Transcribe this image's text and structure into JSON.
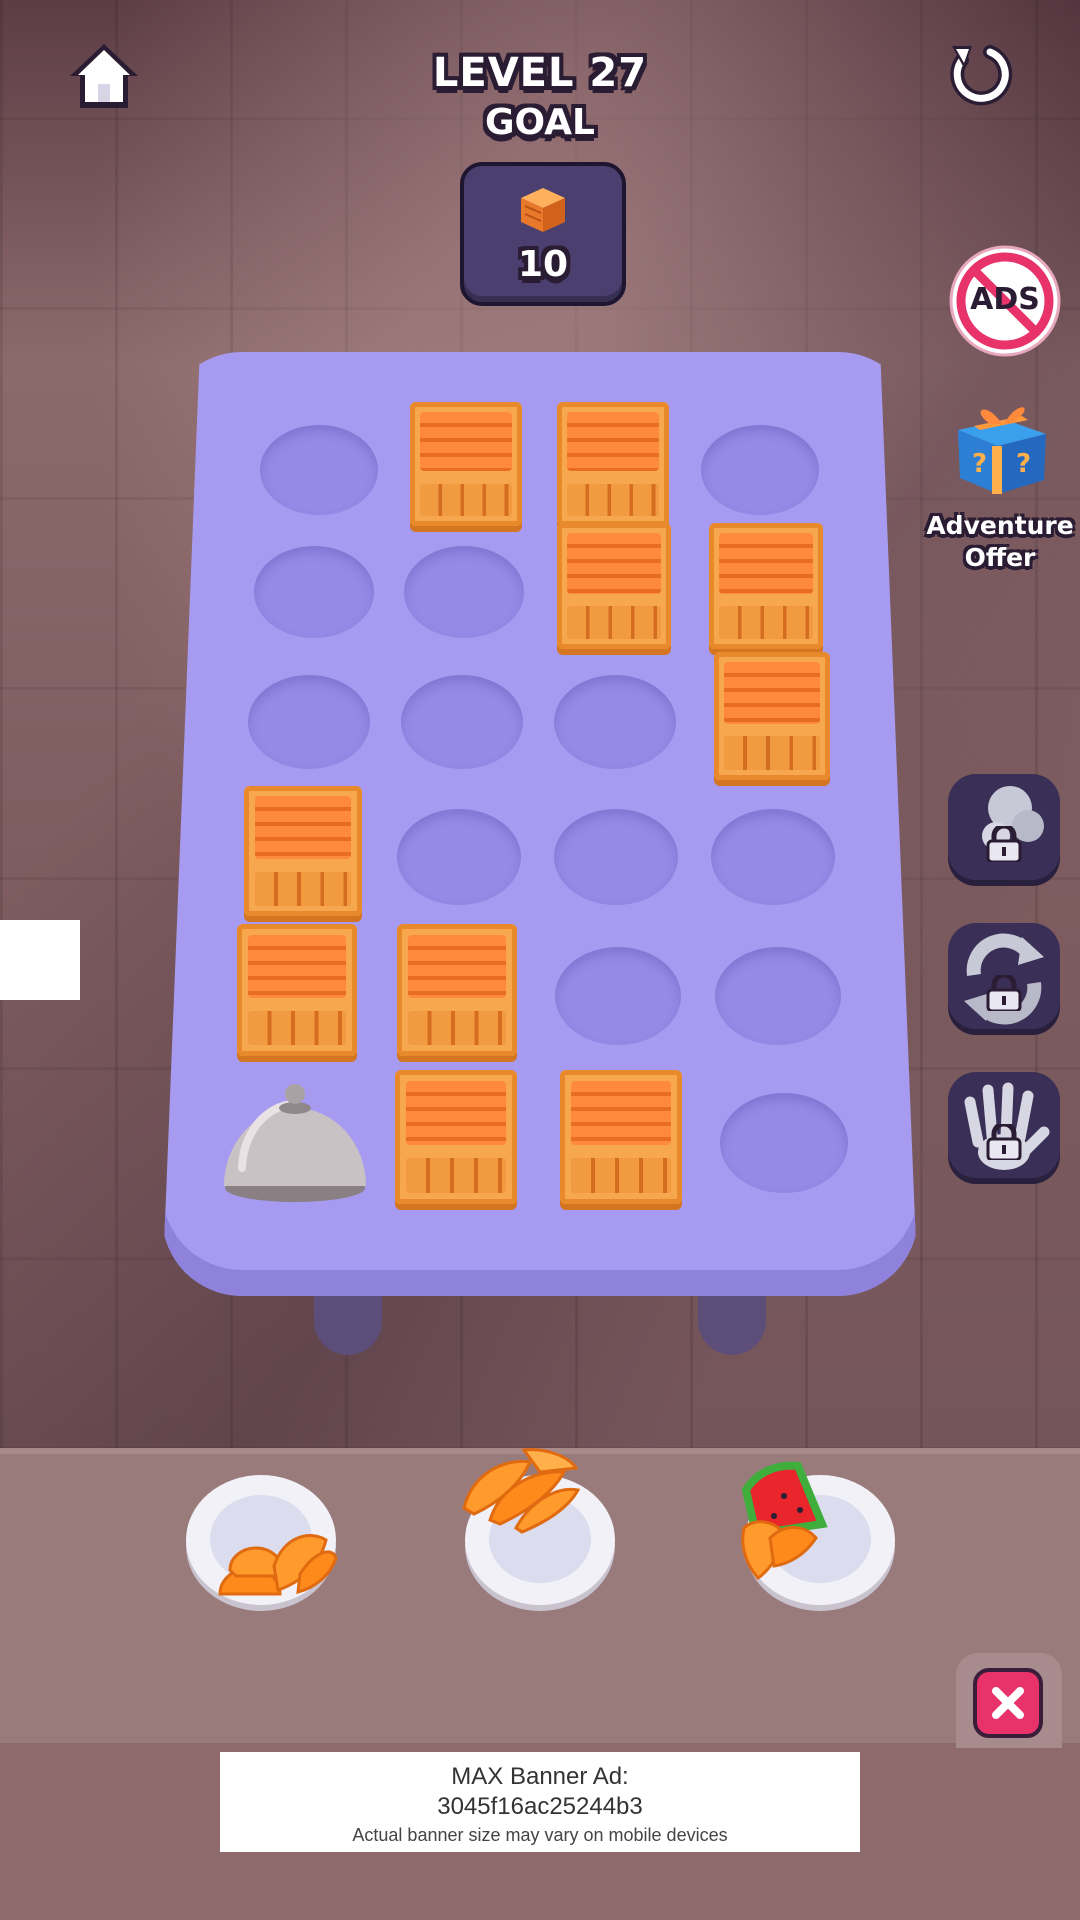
{
  "header": {
    "level_label": "LEVEL 27",
    "goal_label": "GOAL",
    "goal_item_icon": "crate-icon",
    "goal_count": "10"
  },
  "toolbar": {
    "home_icon": "home-icon",
    "restart_icon": "restart-icon"
  },
  "side_panel": {
    "no_ads_icon": "no-ads-icon",
    "no_ads_text": "ADS",
    "adventure_offer_line1": "Adventure",
    "adventure_offer_line2": "Offer",
    "boosters": [
      {
        "icon": "magnet-booster-icon",
        "locked": true
      },
      {
        "icon": "shuffle-booster-icon",
        "locked": true
      },
      {
        "icon": "grab-hand-booster-icon",
        "locked": true
      }
    ]
  },
  "board": {
    "rows": 6,
    "cols": 4,
    "cells": [
      [
        "empty",
        "crate",
        "crate",
        "empty"
      ],
      [
        "empty",
        "empty",
        "crate",
        "crate"
      ],
      [
        "empty",
        "empty",
        "empty",
        "crate"
      ],
      [
        "crate",
        "empty",
        "empty",
        "empty"
      ],
      [
        "crate",
        "crate",
        "empty",
        "empty"
      ],
      [
        "cloche",
        "crate",
        "crate",
        "empty"
      ]
    ]
  },
  "plates": [
    {
      "food": "orange-slices"
    },
    {
      "food": "orange-slices"
    },
    {
      "food": "watermelon-and-orange-slices"
    }
  ],
  "colors": {
    "table": "#a79bf1",
    "hole": "#958ae6",
    "crate": "#f7a84f",
    "close_button": "#e8326a"
  },
  "ad_banner": {
    "line1": "MAX Banner Ad:",
    "line2": "3045f16ac25244b3",
    "line3": "Actual banner size may vary on mobile devices"
  }
}
